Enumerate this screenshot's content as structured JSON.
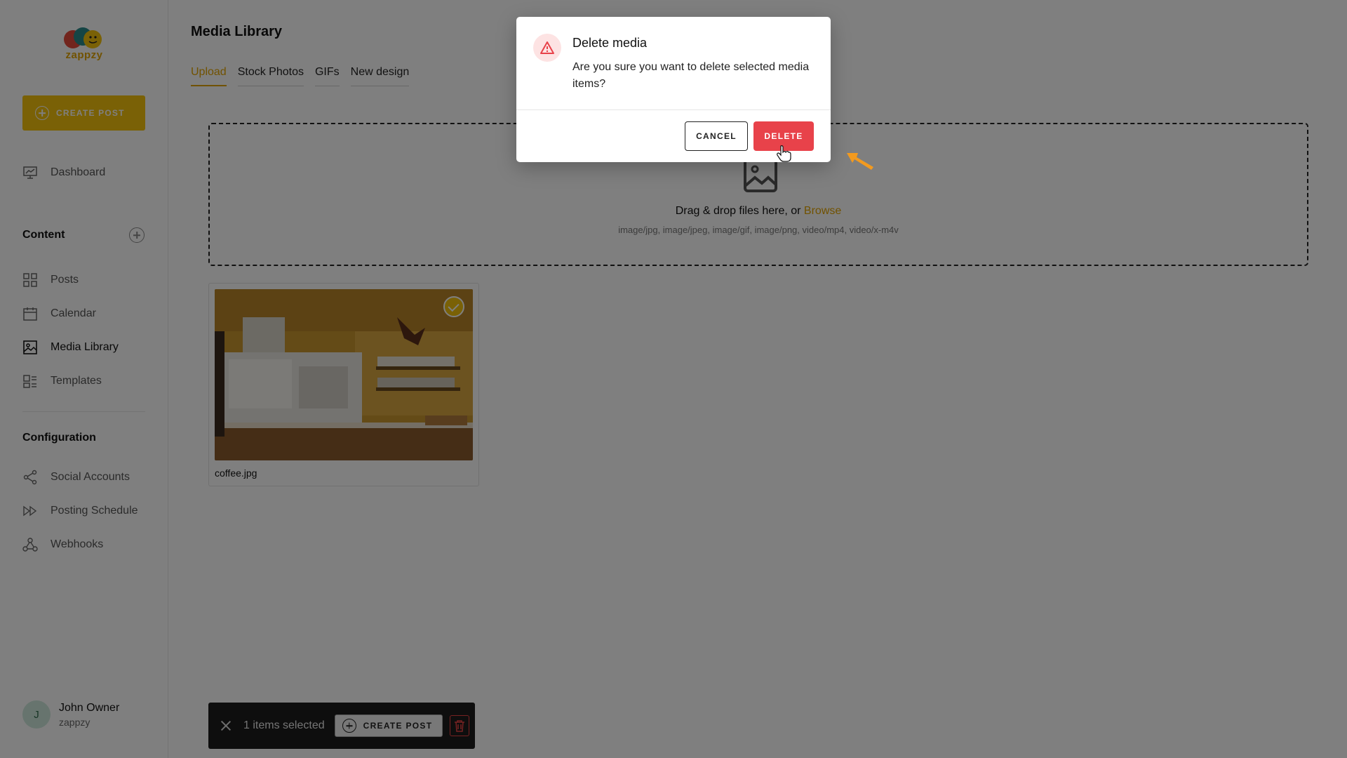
{
  "app": {
    "logo_text": "zappzy"
  },
  "sidebar": {
    "create_post_label": "CREATE POST",
    "dashboard_label": "Dashboard",
    "content_title": "Content",
    "content_items": [
      {
        "label": "Posts",
        "icon": "grid-icon"
      },
      {
        "label": "Calendar",
        "icon": "calendar-icon"
      },
      {
        "label": "Media Library",
        "icon": "image-icon",
        "active": true
      },
      {
        "label": "Templates",
        "icon": "templates-icon"
      }
    ],
    "configuration_title": "Configuration",
    "config_items": [
      {
        "label": "Social Accounts",
        "icon": "share-icon"
      },
      {
        "label": "Posting Schedule",
        "icon": "fast-forward-icon"
      },
      {
        "label": "Webhooks",
        "icon": "webhook-icon"
      }
    ]
  },
  "user": {
    "initial": "J",
    "name": "John Owner",
    "org": "zappzy"
  },
  "main": {
    "title": "Media Library",
    "tabs": [
      {
        "label": "Upload",
        "active": true
      },
      {
        "label": "Stock Photos"
      },
      {
        "label": "GIFs"
      },
      {
        "label": "New design"
      }
    ],
    "dropzone": {
      "text": "Drag & drop files here, or",
      "browse": "Browse",
      "types": "image/jpg, image/jpeg, image/gif, image/png, video/mp4, video/x-m4v"
    },
    "media": [
      {
        "filename": "coffee.jpg",
        "selected": true
      }
    ]
  },
  "bulk_bar": {
    "selected_text": "1 items selected",
    "create_post_label": "CREATE POST"
  },
  "modal": {
    "title": "Delete media",
    "message": "Are you sure you want to delete selected media items?",
    "cancel_label": "CANCEL",
    "delete_label": "DELETE"
  },
  "colors": {
    "accent": "#f4c20d",
    "accent_text": "#e2a400",
    "danger": "#e8424a",
    "overlay": "rgba(0,0,0,0.5)"
  }
}
